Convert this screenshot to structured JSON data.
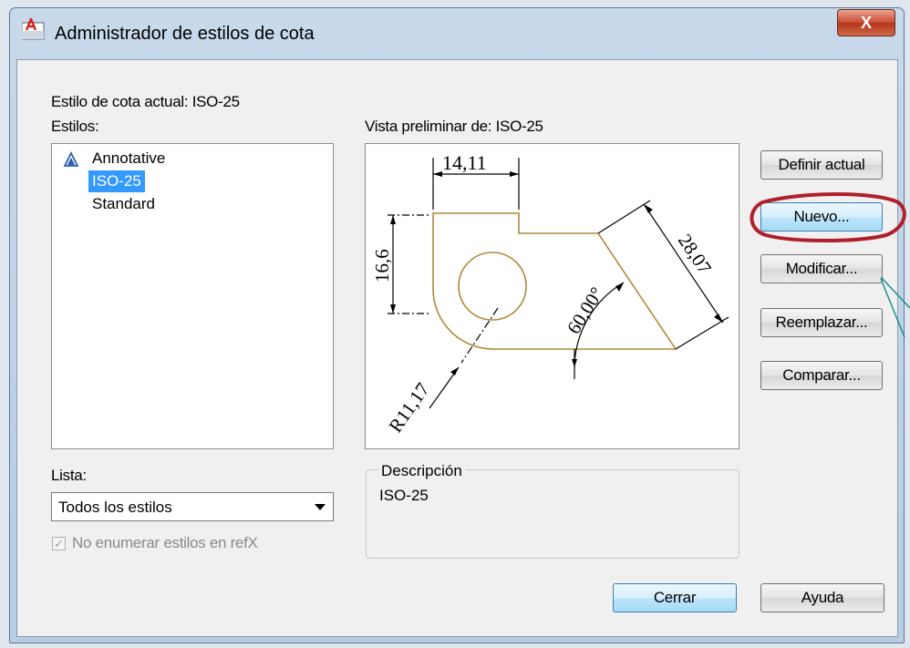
{
  "window": {
    "title": "Administrador de estilos de cota",
    "close_label": "X"
  },
  "current_style": {
    "label": "Estilo de cota actual: ISO-25"
  },
  "styles": {
    "label": "Estilos:",
    "items": [
      {
        "label": "Annotative",
        "icon": "annotative-icon",
        "selected": false
      },
      {
        "label": "ISO-25",
        "selected": true
      },
      {
        "label": "Standard",
        "selected": false
      }
    ]
  },
  "preview": {
    "label": "Vista preliminar de: ISO-25",
    "drawing": {
      "dim_top": "14,11",
      "dim_left": "16,6",
      "dim_right": "28,07",
      "dim_angle": "60,00°",
      "dim_radius": "R11,17"
    },
    "colors": {
      "geometry": "#b08a3c",
      "dimension": "#000000"
    }
  },
  "list_filter": {
    "label": "Lista:",
    "value": "Todos los estilos",
    "checkbox_label": "No enumerar estilos en refX",
    "checkbox_checked": true,
    "checkbox_disabled": true
  },
  "description": {
    "legend": "Descripción",
    "text": "ISO-25"
  },
  "buttons": {
    "set_current": "Definir actual",
    "new": "Nuevo...",
    "modify": "Modificar...",
    "override": "Reemplazar...",
    "compare": "Comparar...",
    "close": "Cerrar",
    "help": "Ayuda"
  },
  "annotation": {
    "highlight_color": "#b0202a",
    "pointer_color": "#1f8f8a"
  }
}
